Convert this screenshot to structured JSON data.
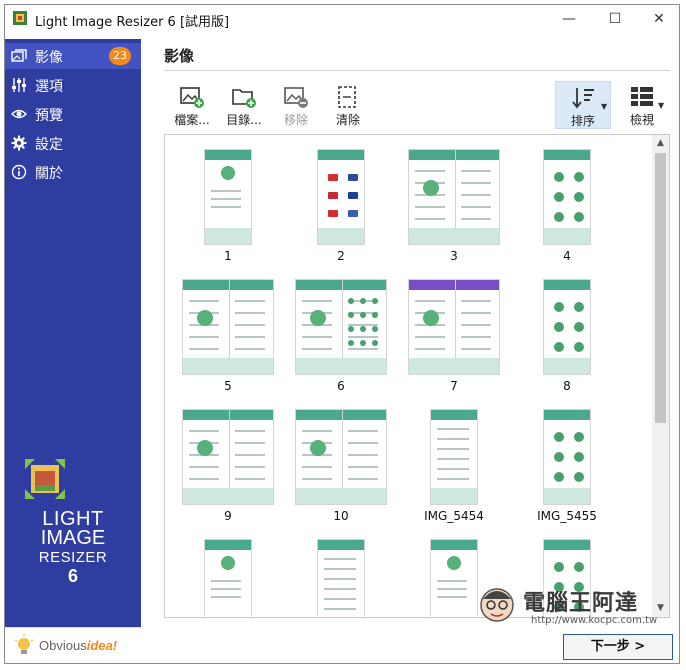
{
  "window": {
    "title": "Light Image Resizer 6  [試用版]",
    "controls": {
      "minimize": "—",
      "maximize": "☐",
      "close": "✕"
    }
  },
  "sidebar": {
    "items": [
      {
        "label": "影像",
        "icon": "images-icon",
        "badge": "23",
        "active": true
      },
      {
        "label": "選項",
        "icon": "sliders-icon"
      },
      {
        "label": "預覽",
        "icon": "eye-icon"
      },
      {
        "label": "設定",
        "icon": "gear-icon"
      },
      {
        "label": "關於",
        "icon": "info-icon"
      }
    ],
    "logo": {
      "line1": "LIGHT",
      "line2": "IMAGE",
      "line3": "RESIZER",
      "line4": "6"
    },
    "brand": {
      "part1": "Obvious",
      "part2": "idea!"
    }
  },
  "main": {
    "title": "影像",
    "toolbar": {
      "files": "檔案...",
      "folder": "目錄...",
      "remove": "移除",
      "clear": "清除",
      "sort": "排序",
      "view": "檢視"
    },
    "thumbnails": [
      {
        "caption": "1",
        "kind": "single"
      },
      {
        "caption": "2",
        "kind": "single-flags"
      },
      {
        "caption": "3",
        "kind": "double"
      },
      {
        "caption": "4",
        "kind": "single-dots"
      },
      {
        "caption": "5",
        "kind": "double"
      },
      {
        "caption": "6",
        "kind": "double-grid"
      },
      {
        "caption": "7",
        "kind": "double-purple"
      },
      {
        "caption": "8",
        "kind": "single-dots"
      },
      {
        "caption": "9",
        "kind": "double-list"
      },
      {
        "caption": "10",
        "kind": "double-list"
      },
      {
        "caption": "IMG_5454",
        "kind": "single-list"
      },
      {
        "caption": "IMG_5455",
        "kind": "single-dots"
      },
      {
        "caption": "",
        "kind": "single"
      },
      {
        "caption": "",
        "kind": "single-list"
      },
      {
        "caption": "",
        "kind": "single"
      },
      {
        "caption": "",
        "kind": "single-grid"
      }
    ],
    "next_button": "下一步 >"
  },
  "watermark": {
    "text": "電腦王阿達",
    "url": "http://www.kocpc.com.tw"
  },
  "colors": {
    "sidebar": "#2f3da1",
    "badge": "#f08a1e",
    "accent": "#4aa88f",
    "selected_tool": "#dceaf7"
  }
}
